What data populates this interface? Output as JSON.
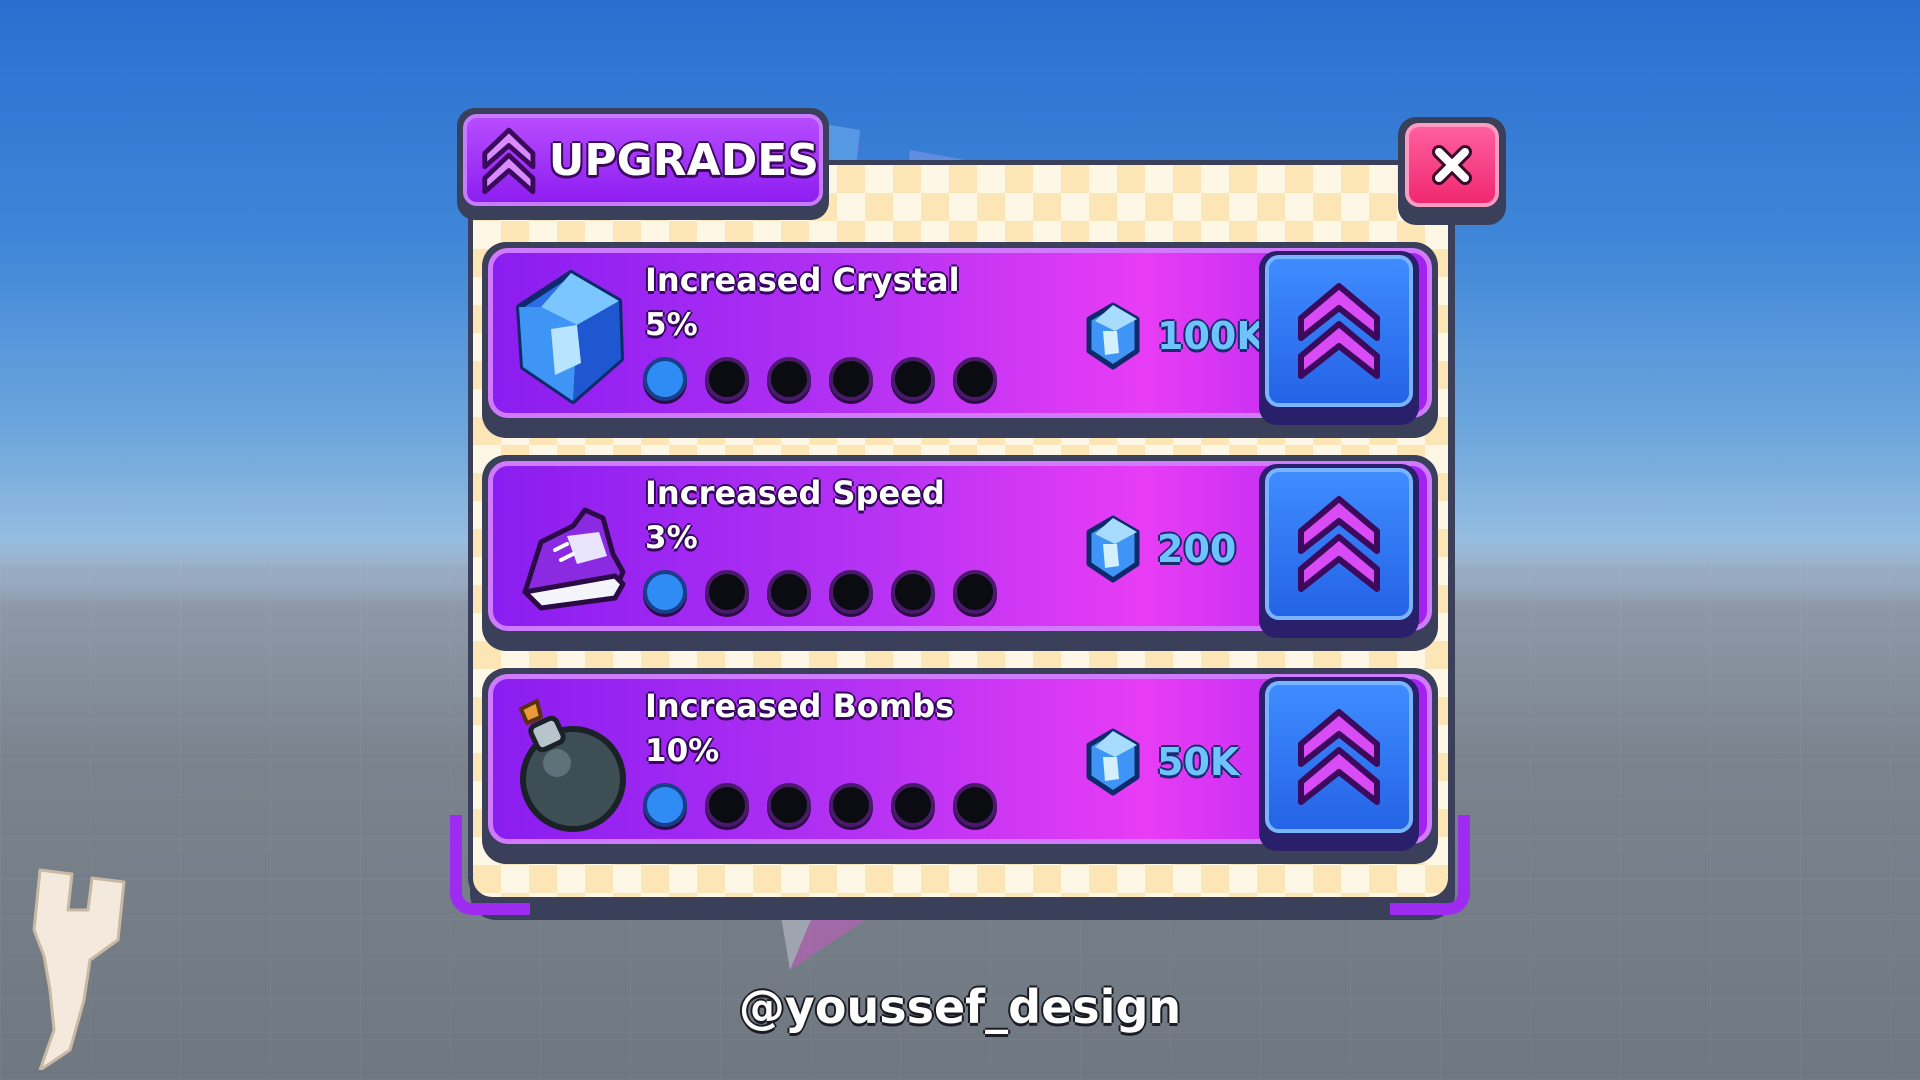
{
  "window": {
    "title": "UPGRADES",
    "close_label": "×"
  },
  "upgrades": [
    {
      "name": "Increased Crystal",
      "percent": "5%",
      "icon": "crystal-icon",
      "level_filled": 1,
      "level_total": 6,
      "cost": "100K",
      "cost_icon": "gem-icon"
    },
    {
      "name": "Increased Speed",
      "percent": "3%",
      "icon": "shoe-icon",
      "level_filled": 1,
      "level_total": 6,
      "cost": "200",
      "cost_icon": "gem-icon"
    },
    {
      "name": "Increased Bombs",
      "percent": "10%",
      "icon": "bomb-icon",
      "level_filled": 1,
      "level_total": 6,
      "cost": "50K",
      "cost_icon": "gem-icon"
    }
  ],
  "footer": {
    "credit": "@youssef_design"
  },
  "colors": {
    "panel_bg": "#fff7e6",
    "card_purple": "#b532f3",
    "buy_blue": "#2f7cf5",
    "close_pink": "#f0286f",
    "level_filled": "#2f8cf5",
    "level_empty": "#0b0b12"
  }
}
